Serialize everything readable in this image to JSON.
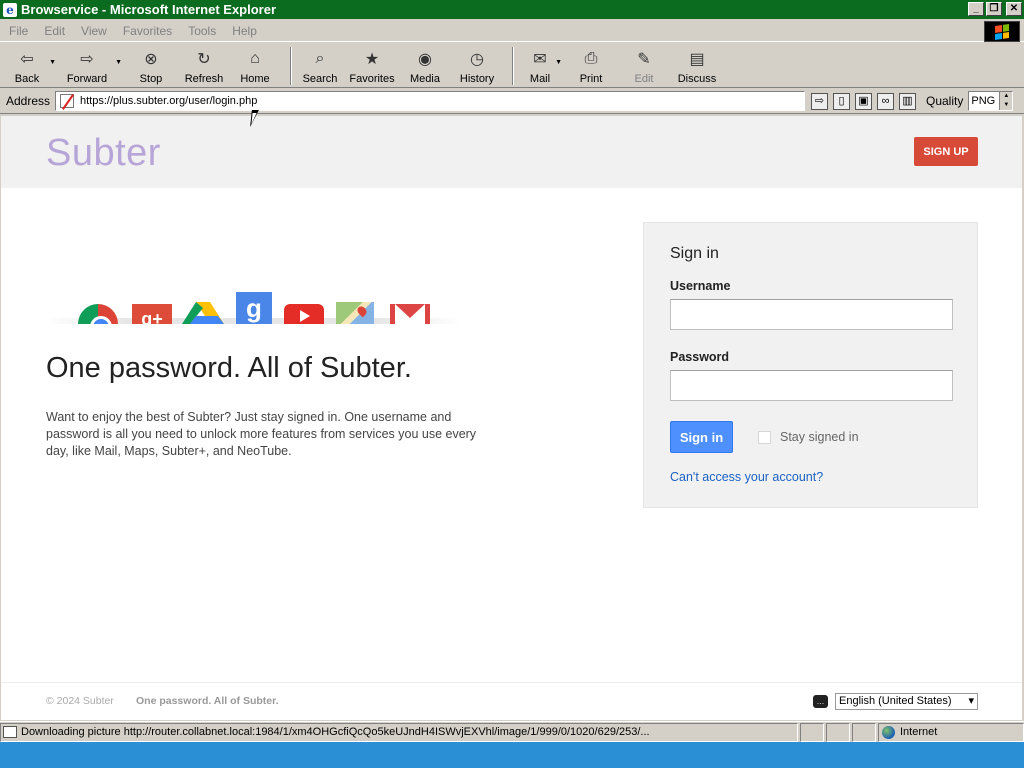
{
  "window": {
    "title": "Browservice - Microsoft Internet Explorer",
    "controls": {
      "minimize": "_",
      "restore": "❐",
      "close": "✕"
    }
  },
  "menubar": [
    "File",
    "Edit",
    "View",
    "Favorites",
    "Tools",
    "Help"
  ],
  "toolbar": {
    "back": "Back",
    "forward": "Forward",
    "stop": "Stop",
    "refresh": "Refresh",
    "home": "Home",
    "search": "Search",
    "favorites": "Favorites",
    "media": "Media",
    "history": "History",
    "mail": "Mail",
    "print": "Print",
    "edit": "Edit",
    "discuss": "Discuss"
  },
  "addressbar": {
    "label": "Address",
    "url": "https://plus.subter.org/user/login.php",
    "quality_label": "Quality",
    "quality_value": "PNG"
  },
  "page": {
    "logo": "Subter",
    "signup": "SIGN UP",
    "headline": "One password. All of Subter.",
    "description": "Want to enjoy the best of Subter? Just stay signed in. One username and password is all you need to unlock more features from services you use every day, like Mail, Maps, Subter+, and NeoTube.",
    "products": [
      "chrome-icon",
      "google-plus-icon",
      "drive-icon",
      "google-search-icon",
      "youtube-icon",
      "maps-icon",
      "gmail-icon"
    ],
    "gplus_glyph": "g+",
    "gsearch_glyph": "g",
    "signin": {
      "title": "Sign in",
      "username_label": "Username",
      "username_value": "",
      "password_label": "Password",
      "password_value": "",
      "button": "Sign in",
      "stay_signed_in": "Stay signed in",
      "stay_checked": false,
      "forgot": "Can't access your account?"
    },
    "footer": {
      "copyright": "© 2024 Subter",
      "tagline": "One password. All of Subter.",
      "language": "English (United States)"
    }
  },
  "statusbar": {
    "text": "Downloading picture http://router.collabnet.local:1984/1/xm4OHGcfiQcQo5keUJndH4ISWvjEXVhl/image/1/999/0/1020/629/253/...",
    "zone": "Internet"
  },
  "colors": {
    "titlebar": "#0b6b1e",
    "signup_button": "#d84a38",
    "signin_button": "#4d90fe",
    "link": "#1a62c4",
    "logo": "#b7a5d8"
  }
}
